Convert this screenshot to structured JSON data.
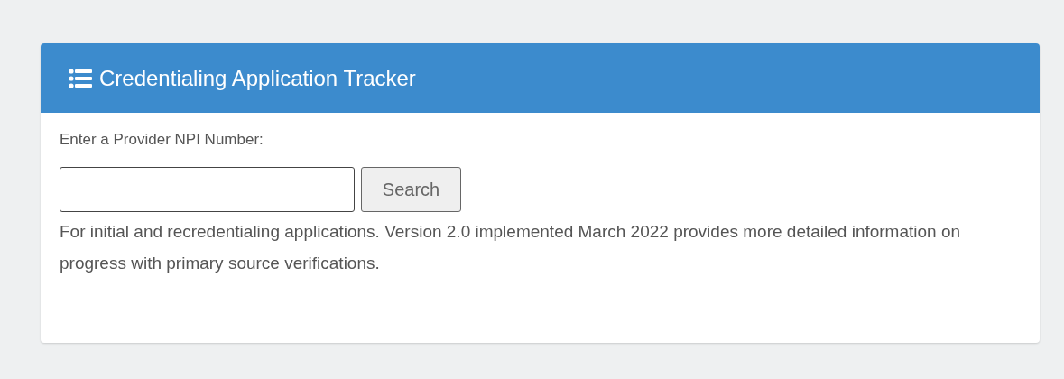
{
  "panel": {
    "title": "Credentialing Application Tracker"
  },
  "search": {
    "label": "Enter a Provider NPI Number:",
    "button": "Search"
  },
  "description": "For initial and recredentialing applications. Version 2.0 implemented March 2022 provides more detailed information on progress with primary source verifications."
}
